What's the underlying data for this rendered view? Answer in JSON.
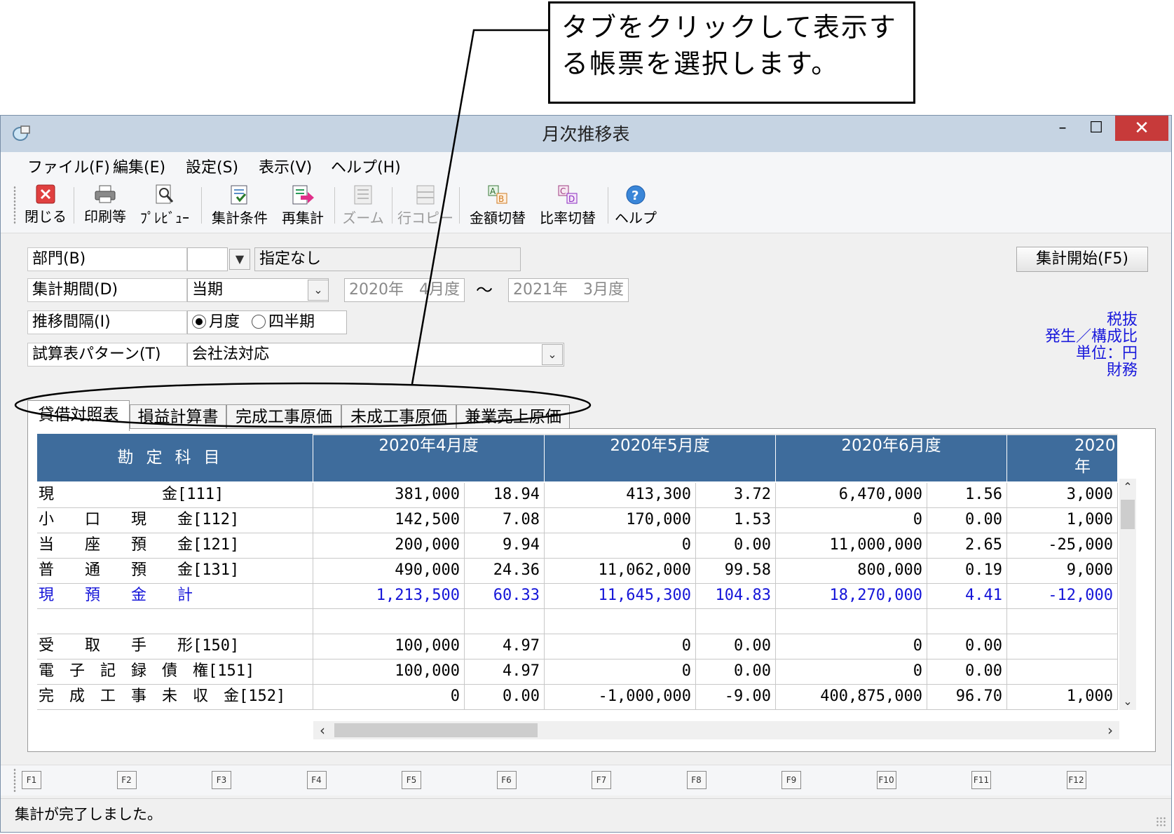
{
  "callout": {
    "line1": "タブをクリックして表示す",
    "line2": "る帳票を選択します。"
  },
  "window": {
    "title": "月次推移表",
    "min": "–",
    "max": "☐",
    "close": "✕"
  },
  "menu": [
    {
      "label": "ファイル(F)"
    },
    {
      "label": "編集(E)"
    },
    {
      "label": "設定(S)"
    },
    {
      "label": "表示(V)"
    },
    {
      "label": "ヘルプ(H)"
    }
  ],
  "toolbar": {
    "close": "閉じる",
    "print": "印刷等",
    "preview": "ﾌﾟﾚﾋﾞｭｰ",
    "conditions": "集計条件",
    "recalc": "再集計",
    "zoom": "ズーム",
    "rowcopy": "行コピー",
    "amount_switch": "金額切替",
    "ratio_switch": "比率切替",
    "help": "ヘルプ"
  },
  "form": {
    "dept_label": "部門(B)",
    "dept_code": "",
    "dept_name": "指定なし",
    "period_label": "集計期間(D)",
    "period_value": "当期",
    "period_from": "2020年　4月度",
    "tilde": "～",
    "period_to": "2021年　3月度",
    "interval_label": "推移間隔(I)",
    "interval_month": "月度",
    "interval_quarter": "四半期",
    "pattern_label": "試算表パターン(T)",
    "pattern_value": "会社法対応",
    "start_button": "集計開始(F5)"
  },
  "info": {
    "tax": "税抜",
    "ratio": "発生／構成比",
    "unit": "単位：円",
    "type": "財務"
  },
  "tabs": [
    {
      "label": "貸借対照表",
      "active": true
    },
    {
      "label": "損益計算書"
    },
    {
      "label": "完成工事原価"
    },
    {
      "label": "未成工事原価"
    },
    {
      "label": "兼業売上原価"
    }
  ],
  "grid": {
    "account_header": "勘定科目",
    "months": [
      "2020年4月度",
      "2020年5月度",
      "2020年6月度",
      "2020年"
    ],
    "rows": [
      {
        "name": "現　　　　　　　金[111]",
        "v": [
          "381,000",
          "18.94",
          "413,300",
          "3.72",
          "6,470,000",
          "1.56",
          "3,000"
        ]
      },
      {
        "name": "小　　口　　現　　金[112]",
        "v": [
          "142,500",
          "7.08",
          "170,000",
          "1.53",
          "0",
          "0.00",
          "1,000"
        ]
      },
      {
        "name": "当　　座　　預　　金[121]",
        "v": [
          "200,000",
          "9.94",
          "0",
          "0.00",
          "11,000,000",
          "2.65",
          "-25,000"
        ]
      },
      {
        "name": "普　　通　　預　　金[131]",
        "v": [
          "490,000",
          "24.36",
          "11,062,000",
          "99.58",
          "800,000",
          "0.19",
          "9,000"
        ]
      },
      {
        "name": "現　　預　　金　　計",
        "v": [
          "1,213,500",
          "60.33",
          "11,645,300",
          "104.83",
          "18,270,000",
          "4.41",
          "-12,000"
        ],
        "blue": true
      },
      {
        "name": "",
        "v": [
          "",
          "",
          "",
          "",
          "",
          "",
          ""
        ]
      },
      {
        "name": "受　　取　　手　　形[150]",
        "v": [
          "100,000",
          "4.97",
          "0",
          "0.00",
          "0",
          "0.00",
          ""
        ]
      },
      {
        "name": "電　子　記　録　債　権[151]",
        "v": [
          "100,000",
          "4.97",
          "0",
          "0.00",
          "0",
          "0.00",
          ""
        ]
      },
      {
        "name": "完　成　工　事　未　収　金[152]",
        "v": [
          "0",
          "0.00",
          "-1,000,000",
          "-9.00",
          "400,875,000",
          "96.70",
          "1,000"
        ]
      }
    ]
  },
  "fkeys": [
    "F1",
    "F2",
    "F3",
    "F4",
    "F5",
    "F6",
    "F7",
    "F8",
    "F9",
    "F10",
    "F11",
    "F12"
  ],
  "status": "集計が完了しました。",
  "colors": {
    "header_blue": "#3e6c9c",
    "total_blue": "#1515d8",
    "close_red": "#c73a3a"
  }
}
